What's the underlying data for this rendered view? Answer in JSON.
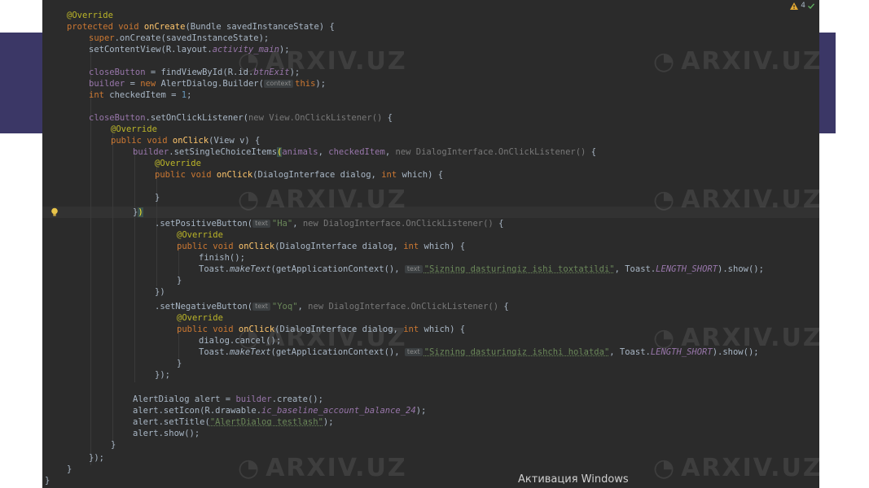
{
  "editor": {
    "warning_count": "4",
    "watermark_text": "ARXIV.UZ",
    "activation_text": "Активация Windows",
    "hints": {
      "context": "context",
      "text": "text"
    },
    "code": {
      "l1_ann": "@Override",
      "l2_kw1": "protected",
      "l2_kw2": "void",
      "l2_fn": "onCreate",
      "l2_rest": "(Bundle savedInstanceState) {",
      "l3_kw": "super",
      "l3_rest": ".onCreate(savedInstanceState);",
      "l4_a": "setContentView(R.layout.",
      "l4_f": "activity_main",
      "l4_b": ");",
      "l6_f": "closeButton",
      "l6_a": " = findViewById(R.id.",
      "l6_f2": "btnExit",
      "l6_b": ");",
      "l7_f": "builder",
      "l7_a": " = ",
      "l7_kw": "new",
      "l7_b": " AlertDialog.Builder(",
      "l7_kw2": "this",
      "l7_c": ");",
      "l8_kw": "int",
      "l8_a": " checkedItem = ",
      "l8_num": "1",
      "l8_b": ";",
      "l10_f": "closeButton",
      "l10_a": ".setOnClickListener(",
      "l10_dim": "new View.OnClickListener()",
      "l10_b": " {",
      "l11_ann": "@Override",
      "l12_kw1": "public",
      "l12_kw2": "void",
      "l12_fn": "onClick",
      "l12_rest": "(View v) {",
      "l13_f": "builder",
      "l13_a": ".setSingleChoiceItems",
      "l13_br": "(",
      "l13_f2": "animals",
      "l13_b": ", ",
      "l13_f3": "checkedItem",
      "l13_c": ", ",
      "l13_dim": "new DialogInterface.OnClickListener()",
      "l13_d": " {",
      "l14_ann": "@Override",
      "l15_kw1": "public",
      "l15_kw2": "void",
      "l15_fn": "onClick",
      "l15_a": "(DialogInterface dialog, ",
      "l15_kw3": "int",
      "l15_b": " which) {",
      "l17": "}",
      "l18_a": "}",
      "l18_hl": ")",
      "l19_a": ".setPositiveButton(",
      "l19_str": "\"Ha\"",
      "l19_b": ", ",
      "l19_dim": "new DialogInterface.OnClickListener()",
      "l19_c": " {",
      "l20_ann": "@Override",
      "l21_kw1": "public",
      "l21_kw2": "void",
      "l21_fn": "onClick",
      "l21_a": "(DialogInterface dialog, ",
      "l21_kw3": "int",
      "l21_b": " which) {",
      "l22": "finish();",
      "l23_a": "Toast.",
      "l23_it": "makeText",
      "l23_b": "(getApplicationContext(), ",
      "l23_str": "\"Sizning dasturingiz ishi toxtatildi\"",
      "l23_c": ", Toast.",
      "l23_const": "LENGTH_SHORT",
      "l23_d": ").show();",
      "l24": "}",
      "l25": "})",
      "l26_a": ".setNegativeButton(",
      "l26_str": "\"Yoq\"",
      "l26_b": ", ",
      "l26_dim": "new DialogInterface.OnClickListener()",
      "l26_c": " {",
      "l27_ann": "@Override",
      "l28_kw1": "public",
      "l28_kw2": "void",
      "l28_fn": "onClick",
      "l28_a": "(DialogInterface dialog, ",
      "l28_kw3": "int",
      "l28_b": " which) {",
      "l29": "dialog.cancel();",
      "l30_a": "Toast.",
      "l30_it": "makeText",
      "l30_b": "(getApplicationContext(), ",
      "l30_str": "\"Sizning dasturingiz ishchi holatda\"",
      "l30_c": ", Toast.",
      "l30_const": "LENGTH_SHORT",
      "l30_d": ").show();",
      "l31": "}",
      "l32": "});",
      "l34_a": "AlertDialog alert = ",
      "l34_f": "builder",
      "l34_b": ".create();",
      "l35_a": "alert.setIcon(R.drawable.",
      "l35_f": "ic_baseline_account_balance_24",
      "l35_b": ");",
      "l36_a": "alert.setTitle(",
      "l36_str": "\"AlertDialog testlash\"",
      "l36_b": ");",
      "l37": "alert.show();",
      "l38": "}",
      "l39": "});",
      "l40": "}",
      "l41": "}"
    }
  },
  "colors": {
    "background": "#2b2b2b",
    "keyword": "#cc7832",
    "annotation": "#bbb529",
    "method": "#ffc66d",
    "field": "#9876aa",
    "string": "#6a8759",
    "number": "#6897bb",
    "text": "#a9b7c6",
    "slide_band": "#3b3766"
  }
}
